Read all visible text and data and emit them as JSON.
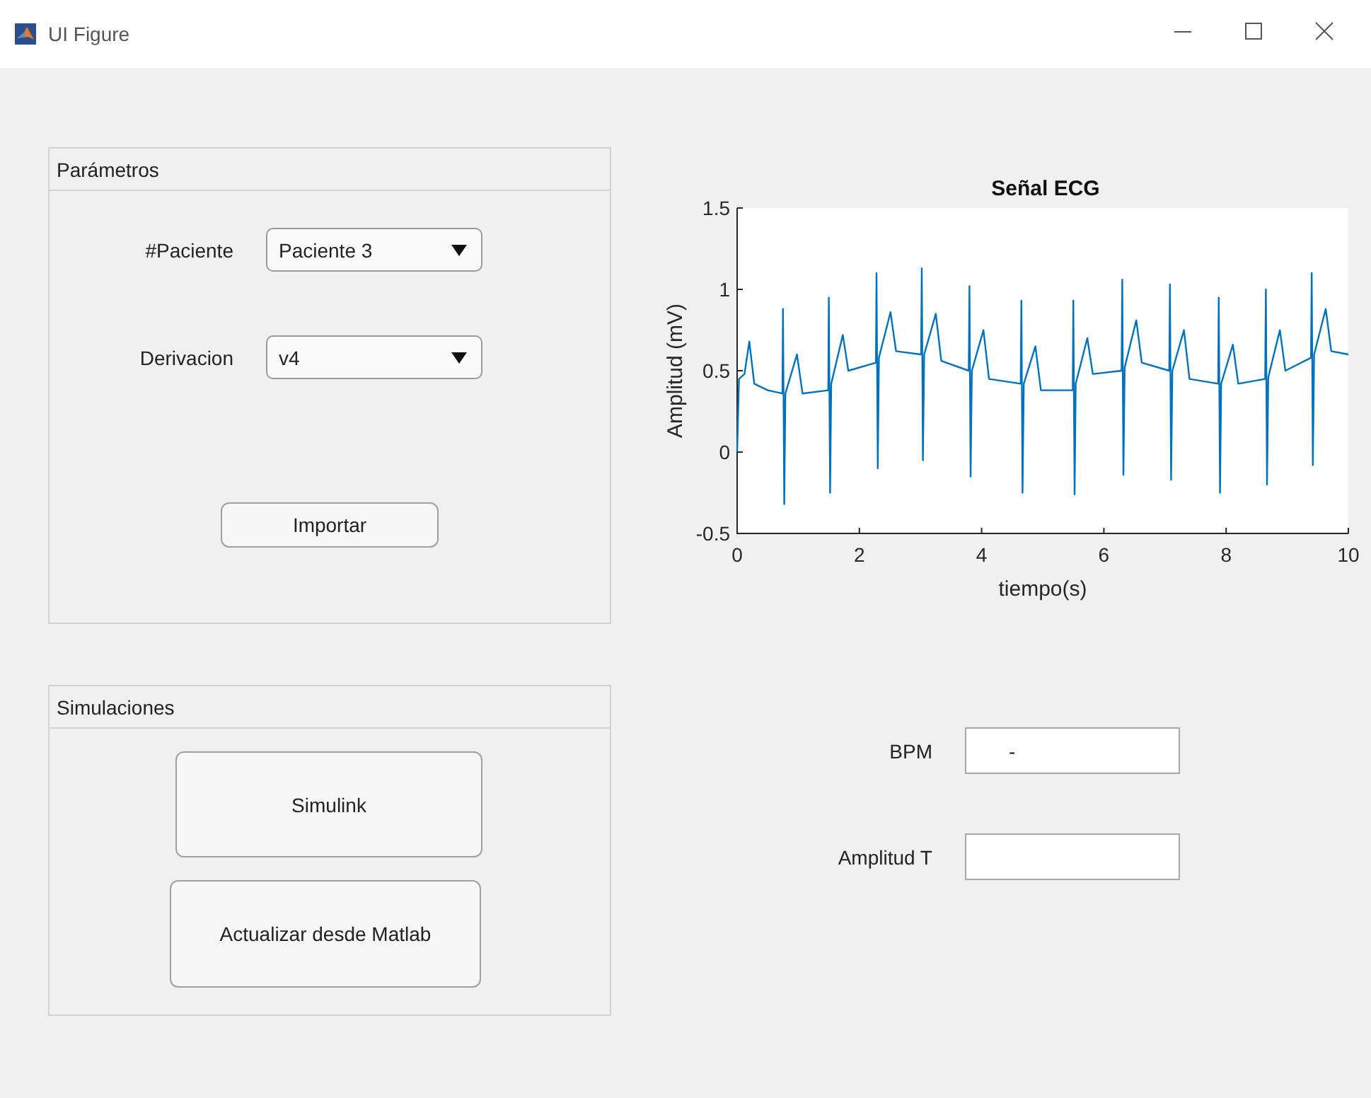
{
  "window": {
    "title": "UI Figure"
  },
  "parameters_panel": {
    "title": "Parámetros",
    "fields": [
      {
        "label": "#Paciente",
        "value": "Paciente 3"
      },
      {
        "label": "Derivacion",
        "value": "v4"
      }
    ],
    "button": "Importar"
  },
  "simulations_panel": {
    "title": "Simulaciones",
    "buttons": [
      "Simulink",
      "Actualizar desde Matlab"
    ]
  },
  "plot": {
    "chart_data": {
      "type": "line",
      "title": "Señal ECG",
      "xlabel": "tiempo(s)",
      "ylabel": "Amplitud (mV)",
      "xlim": [
        0,
        10
      ],
      "ylim": [
        -0.5,
        1.5
      ],
      "xticks": [
        0,
        2,
        4,
        6,
        8,
        10
      ],
      "yticks": [
        -0.5,
        0,
        0.5,
        1,
        1.5
      ],
      "x": [
        0,
        0.03,
        0.12,
        0.2,
        0.28,
        0.5,
        0.74,
        0.75,
        0.77,
        0.79,
        0.98,
        1.07,
        1.49,
        1.5,
        1.52,
        1.54,
        1.73,
        1.82,
        2.27,
        2.28,
        2.3,
        2.32,
        2.51,
        2.6,
        3.01,
        3.02,
        3.04,
        3.06,
        3.25,
        3.34,
        3.79,
        3.8,
        3.82,
        3.84,
        4.03,
        4.12,
        4.64,
        4.65,
        4.67,
        4.69,
        4.88,
        4.97,
        5.49,
        5.5,
        5.52,
        5.54,
        5.73,
        5.82,
        6.29,
        6.3,
        6.32,
        6.34,
        6.53,
        6.62,
        7.07,
        7.08,
        7.1,
        7.12,
        7.31,
        7.4,
        7.87,
        7.88,
        7.9,
        7.92,
        8.11,
        8.2,
        8.64,
        8.65,
        8.67,
        8.69,
        8.88,
        8.97,
        9.39,
        9.4,
        9.42,
        9.44,
        9.63,
        9.72,
        10
      ],
      "series": [
        {
          "color": "#0072bd",
          "values": [
            0,
            0.45,
            0.48,
            0.68,
            0.42,
            0.38,
            0.36,
            0.88,
            -0.32,
            0.36,
            0.6,
            0.36,
            0.38,
            0.95,
            -0.25,
            0.42,
            0.72,
            0.5,
            0.55,
            1.1,
            -0.1,
            0.58,
            0.86,
            0.62,
            0.6,
            1.13,
            -0.05,
            0.6,
            0.85,
            0.56,
            0.5,
            1.02,
            -0.15,
            0.5,
            0.75,
            0.45,
            0.42,
            0.93,
            -0.25,
            0.42,
            0.65,
            0.38,
            0.38,
            0.93,
            -0.26,
            0.42,
            0.7,
            0.48,
            0.5,
            1.06,
            -0.14,
            0.52,
            0.81,
            0.55,
            0.5,
            1.03,
            -0.17,
            0.5,
            0.75,
            0.45,
            0.42,
            0.95,
            -0.25,
            0.42,
            0.66,
            0.42,
            0.45,
            1.0,
            -0.2,
            0.46,
            0.75,
            0.5,
            0.58,
            1.1,
            -0.08,
            0.6,
            0.88,
            0.62,
            0.6
          ]
        }
      ]
    }
  },
  "outputs": [
    {
      "label": "BPM",
      "value": "-"
    },
    {
      "label": "Amplitud T"
    }
  ]
}
